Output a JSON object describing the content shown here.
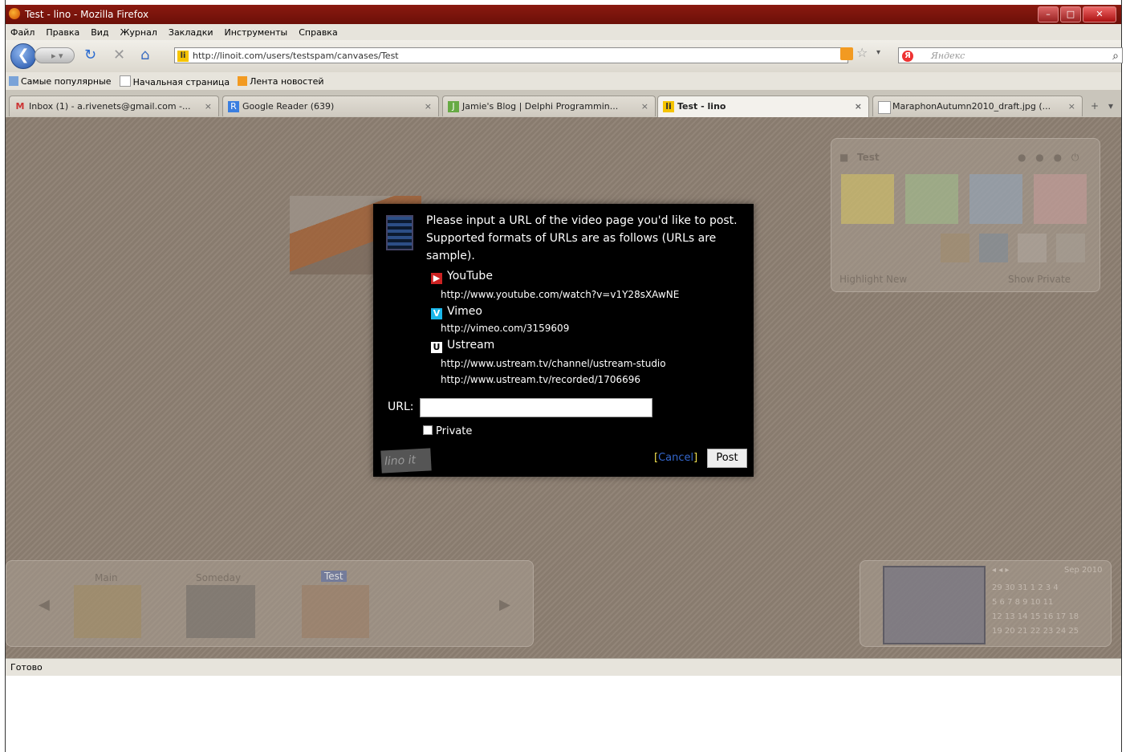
{
  "window": {
    "title": "Test - lino - Mozilla Firefox"
  },
  "menu": [
    "Файл",
    "Правка",
    "Вид",
    "Журнал",
    "Закладки",
    "Инструменты",
    "Справка"
  ],
  "nav": {
    "url": "http://linoit.com/users/testspam/canvases/Test",
    "search_placeholder": "Яндекс"
  },
  "bookmarks": [
    "Самые популярные",
    "Начальная страница",
    "Лента новостей"
  ],
  "tabs": [
    {
      "label": "Inbox (1) - a.rivenets@gmail.com -..."
    },
    {
      "label": "Google Reader (639)"
    },
    {
      "label": "Jamie's Blog | Delphi Programmin..."
    },
    {
      "label": "Test - lino"
    },
    {
      "label": "MaraphonAutumn2010_draft.jpg (..."
    }
  ],
  "right_panel": {
    "title": "Test",
    "highlight": "Highlight New",
    "show_private": "Show Private"
  },
  "bottom_panel": {
    "canvases": [
      "Main",
      "Someday",
      "Test"
    ]
  },
  "calendar": {
    "month": "Sep 2010",
    "rows": [
      "29 30 31 1 2 3 4",
      "5 6 7 8 9 10 11",
      "12 13 14 15 16 17 18",
      "19 20 21 22 23 24 25"
    ]
  },
  "dialog": {
    "intro": "Please input a URL of the video page you'd like to post. Supported formats of URLs are as follows (URLs are sample).",
    "services": [
      {
        "name": "YouTube",
        "icon": "youtube-icon",
        "examples": [
          "http://www.youtube.com/watch?v=v1Y28sXAwNE"
        ]
      },
      {
        "name": "Vimeo",
        "icon": "vimeo-icon",
        "examples": [
          "http://vimeo.com/3159609"
        ]
      },
      {
        "name": "Ustream",
        "icon": "ustream-icon",
        "examples": [
          "http://www.ustream.tv/channel/ustream-studio",
          "http://www.ustream.tv/recorded/1706696"
        ]
      }
    ],
    "url_label": "URL:",
    "url_value": "",
    "private_label": "Private",
    "logo": "lino it",
    "cancel_open": "[",
    "cancel_label": "Cancel",
    "cancel_close": "]",
    "post_label": "Post"
  },
  "status": {
    "text": "Готово"
  }
}
